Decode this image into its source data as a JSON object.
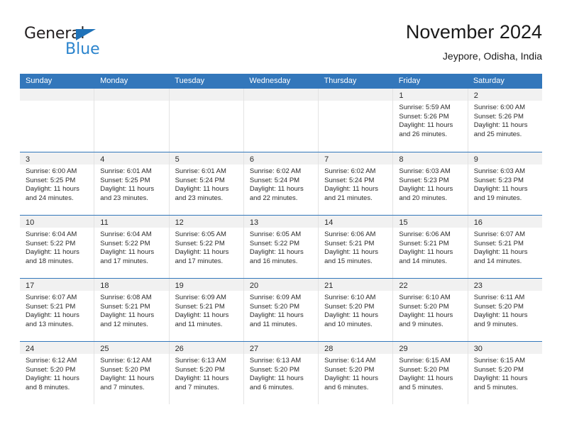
{
  "brand": {
    "name_dark": "General",
    "name_blue": "Blue",
    "accent_blue": "#2b84cd",
    "logo_triangle_color": "#1f72b8"
  },
  "header": {
    "title": "November 2024",
    "subtitle": "Jeypore, Odisha, India"
  },
  "colors": {
    "header_row_blue": "#3377bb",
    "day_band_gray": "#f1f1f1",
    "cell_border": "#e3e3e3",
    "text": "#2b2b2b"
  },
  "weekdays": [
    "Sunday",
    "Monday",
    "Tuesday",
    "Wednesday",
    "Thursday",
    "Friday",
    "Saturday"
  ],
  "weeks": [
    [
      {
        "day": "",
        "empty": true
      },
      {
        "day": "",
        "empty": true
      },
      {
        "day": "",
        "empty": true
      },
      {
        "day": "",
        "empty": true
      },
      {
        "day": "",
        "empty": true
      },
      {
        "day": "1",
        "sunrise": "Sunrise: 5:59 AM",
        "sunset": "Sunset: 5:26 PM",
        "daylight": "Daylight: 11 hours and 26 minutes."
      },
      {
        "day": "2",
        "sunrise": "Sunrise: 6:00 AM",
        "sunset": "Sunset: 5:26 PM",
        "daylight": "Daylight: 11 hours and 25 minutes."
      }
    ],
    [
      {
        "day": "3",
        "sunrise": "Sunrise: 6:00 AM",
        "sunset": "Sunset: 5:25 PM",
        "daylight": "Daylight: 11 hours and 24 minutes."
      },
      {
        "day": "4",
        "sunrise": "Sunrise: 6:01 AM",
        "sunset": "Sunset: 5:25 PM",
        "daylight": "Daylight: 11 hours and 23 minutes."
      },
      {
        "day": "5",
        "sunrise": "Sunrise: 6:01 AM",
        "sunset": "Sunset: 5:24 PM",
        "daylight": "Daylight: 11 hours and 23 minutes."
      },
      {
        "day": "6",
        "sunrise": "Sunrise: 6:02 AM",
        "sunset": "Sunset: 5:24 PM",
        "daylight": "Daylight: 11 hours and 22 minutes."
      },
      {
        "day": "7",
        "sunrise": "Sunrise: 6:02 AM",
        "sunset": "Sunset: 5:24 PM",
        "daylight": "Daylight: 11 hours and 21 minutes."
      },
      {
        "day": "8",
        "sunrise": "Sunrise: 6:03 AM",
        "sunset": "Sunset: 5:23 PM",
        "daylight": "Daylight: 11 hours and 20 minutes."
      },
      {
        "day": "9",
        "sunrise": "Sunrise: 6:03 AM",
        "sunset": "Sunset: 5:23 PM",
        "daylight": "Daylight: 11 hours and 19 minutes."
      }
    ],
    [
      {
        "day": "10",
        "sunrise": "Sunrise: 6:04 AM",
        "sunset": "Sunset: 5:22 PM",
        "daylight": "Daylight: 11 hours and 18 minutes."
      },
      {
        "day": "11",
        "sunrise": "Sunrise: 6:04 AM",
        "sunset": "Sunset: 5:22 PM",
        "daylight": "Daylight: 11 hours and 17 minutes."
      },
      {
        "day": "12",
        "sunrise": "Sunrise: 6:05 AM",
        "sunset": "Sunset: 5:22 PM",
        "daylight": "Daylight: 11 hours and 17 minutes."
      },
      {
        "day": "13",
        "sunrise": "Sunrise: 6:05 AM",
        "sunset": "Sunset: 5:22 PM",
        "daylight": "Daylight: 11 hours and 16 minutes."
      },
      {
        "day": "14",
        "sunrise": "Sunrise: 6:06 AM",
        "sunset": "Sunset: 5:21 PM",
        "daylight": "Daylight: 11 hours and 15 minutes."
      },
      {
        "day": "15",
        "sunrise": "Sunrise: 6:06 AM",
        "sunset": "Sunset: 5:21 PM",
        "daylight": "Daylight: 11 hours and 14 minutes."
      },
      {
        "day": "16",
        "sunrise": "Sunrise: 6:07 AM",
        "sunset": "Sunset: 5:21 PM",
        "daylight": "Daylight: 11 hours and 14 minutes."
      }
    ],
    [
      {
        "day": "17",
        "sunrise": "Sunrise: 6:07 AM",
        "sunset": "Sunset: 5:21 PM",
        "daylight": "Daylight: 11 hours and 13 minutes."
      },
      {
        "day": "18",
        "sunrise": "Sunrise: 6:08 AM",
        "sunset": "Sunset: 5:21 PM",
        "daylight": "Daylight: 11 hours and 12 minutes."
      },
      {
        "day": "19",
        "sunrise": "Sunrise: 6:09 AM",
        "sunset": "Sunset: 5:21 PM",
        "daylight": "Daylight: 11 hours and 11 minutes."
      },
      {
        "day": "20",
        "sunrise": "Sunrise: 6:09 AM",
        "sunset": "Sunset: 5:20 PM",
        "daylight": "Daylight: 11 hours and 11 minutes."
      },
      {
        "day": "21",
        "sunrise": "Sunrise: 6:10 AM",
        "sunset": "Sunset: 5:20 PM",
        "daylight": "Daylight: 11 hours and 10 minutes."
      },
      {
        "day": "22",
        "sunrise": "Sunrise: 6:10 AM",
        "sunset": "Sunset: 5:20 PM",
        "daylight": "Daylight: 11 hours and 9 minutes."
      },
      {
        "day": "23",
        "sunrise": "Sunrise: 6:11 AM",
        "sunset": "Sunset: 5:20 PM",
        "daylight": "Daylight: 11 hours and 9 minutes."
      }
    ],
    [
      {
        "day": "24",
        "sunrise": "Sunrise: 6:12 AM",
        "sunset": "Sunset: 5:20 PM",
        "daylight": "Daylight: 11 hours and 8 minutes."
      },
      {
        "day": "25",
        "sunrise": "Sunrise: 6:12 AM",
        "sunset": "Sunset: 5:20 PM",
        "daylight": "Daylight: 11 hours and 7 minutes."
      },
      {
        "day": "26",
        "sunrise": "Sunrise: 6:13 AM",
        "sunset": "Sunset: 5:20 PM",
        "daylight": "Daylight: 11 hours and 7 minutes."
      },
      {
        "day": "27",
        "sunrise": "Sunrise: 6:13 AM",
        "sunset": "Sunset: 5:20 PM",
        "daylight": "Daylight: 11 hours and 6 minutes."
      },
      {
        "day": "28",
        "sunrise": "Sunrise: 6:14 AM",
        "sunset": "Sunset: 5:20 PM",
        "daylight": "Daylight: 11 hours and 6 minutes."
      },
      {
        "day": "29",
        "sunrise": "Sunrise: 6:15 AM",
        "sunset": "Sunset: 5:20 PM",
        "daylight": "Daylight: 11 hours and 5 minutes."
      },
      {
        "day": "30",
        "sunrise": "Sunrise: 6:15 AM",
        "sunset": "Sunset: 5:20 PM",
        "daylight": "Daylight: 11 hours and 5 minutes."
      }
    ]
  ]
}
